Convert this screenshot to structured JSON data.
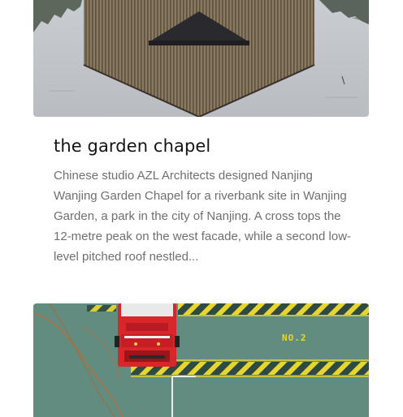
{
  "articles": [
    {
      "title": "the garden chapel",
      "excerpt": "Chinese studio AZL Architects designed Nanjing Wanjing Garden Chapel for a riverbank site in Wanjing Garden, a park in the city of Nanjing. A cross tops the 12-metre peak on the west facade, while a second low-level pitched roof nestled...",
      "image_icon": "chapel-reflection-photo"
    },
    {
      "image_icon": "fire-truck-aerial-photo",
      "image_text": "NO.2"
    }
  ],
  "colors": {
    "title": "#141414",
    "excerpt": "#6f6f6f",
    "ground_green": "#5f8a7c",
    "hazard_yellow": "#e8d530",
    "truck_red": "#d8262b"
  }
}
